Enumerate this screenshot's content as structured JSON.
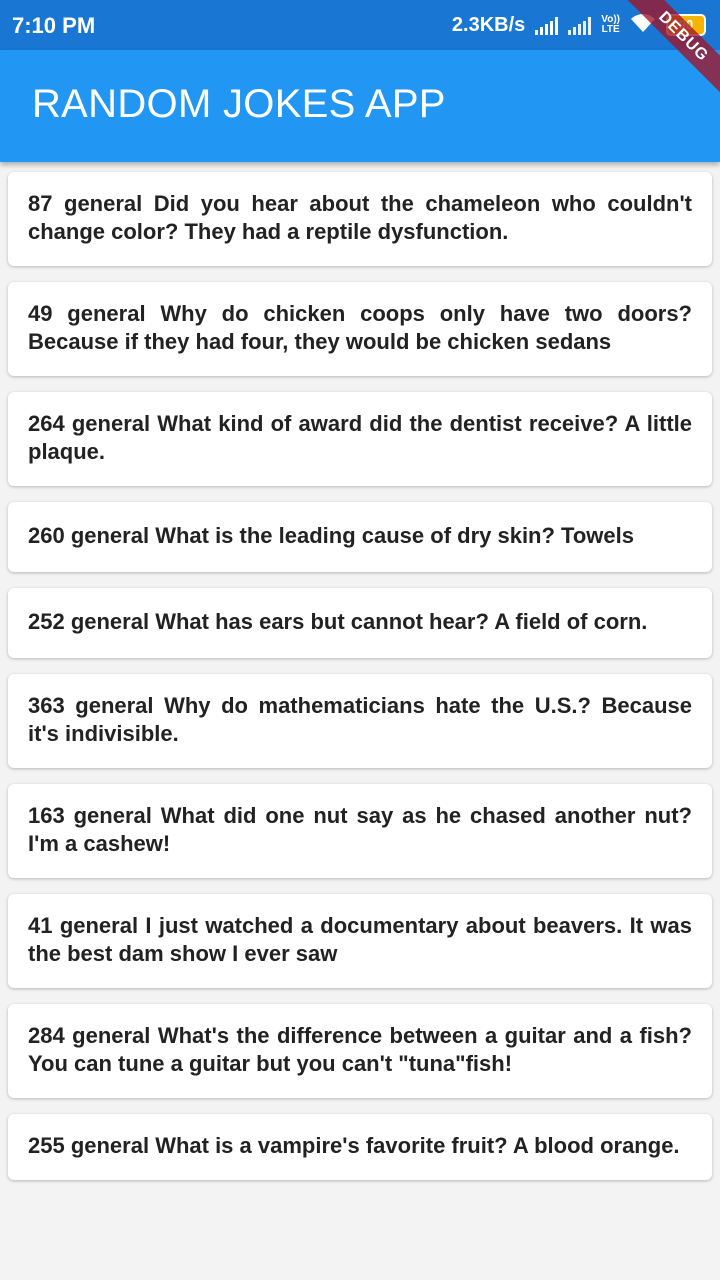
{
  "status_bar": {
    "time": "7:10 PM",
    "net_speed": "2.3KB/s",
    "volte_top": "Vo))",
    "volte_bottom": "LTE",
    "battery": "90"
  },
  "debug_banner": "DEBUG",
  "app_bar": {
    "title": "RANDOM JOKES APP"
  },
  "jokes": [
    {
      "text": "87 general Did you hear about the chameleon who couldn't change color? They had a reptile dysfunction."
    },
    {
      "text": "49 general Why do chicken coops only have two doors? Because if they had four, they would be chicken sedans"
    },
    {
      "text": "264 general What kind of award did the dentist receive? A little plaque."
    },
    {
      "text": "260 general What is the leading cause of dry skin? Towels"
    },
    {
      "text": "252 general What has ears but cannot hear? A field of corn."
    },
    {
      "text": "363 general Why do mathematicians hate the U.S.? Because it's indivisible."
    },
    {
      "text": "163 general What did one nut say as he chased another nut? I'm a cashew!"
    },
    {
      "text": "41 general I just watched a documentary about beavers. It was the best dam show I ever saw"
    },
    {
      "text": "284 general What's the difference between a guitar and a fish? You can tune a guitar but you can't \"tuna\"fish!"
    },
    {
      "text": "255 general What is a vampire's favorite fruit? A blood orange."
    }
  ]
}
